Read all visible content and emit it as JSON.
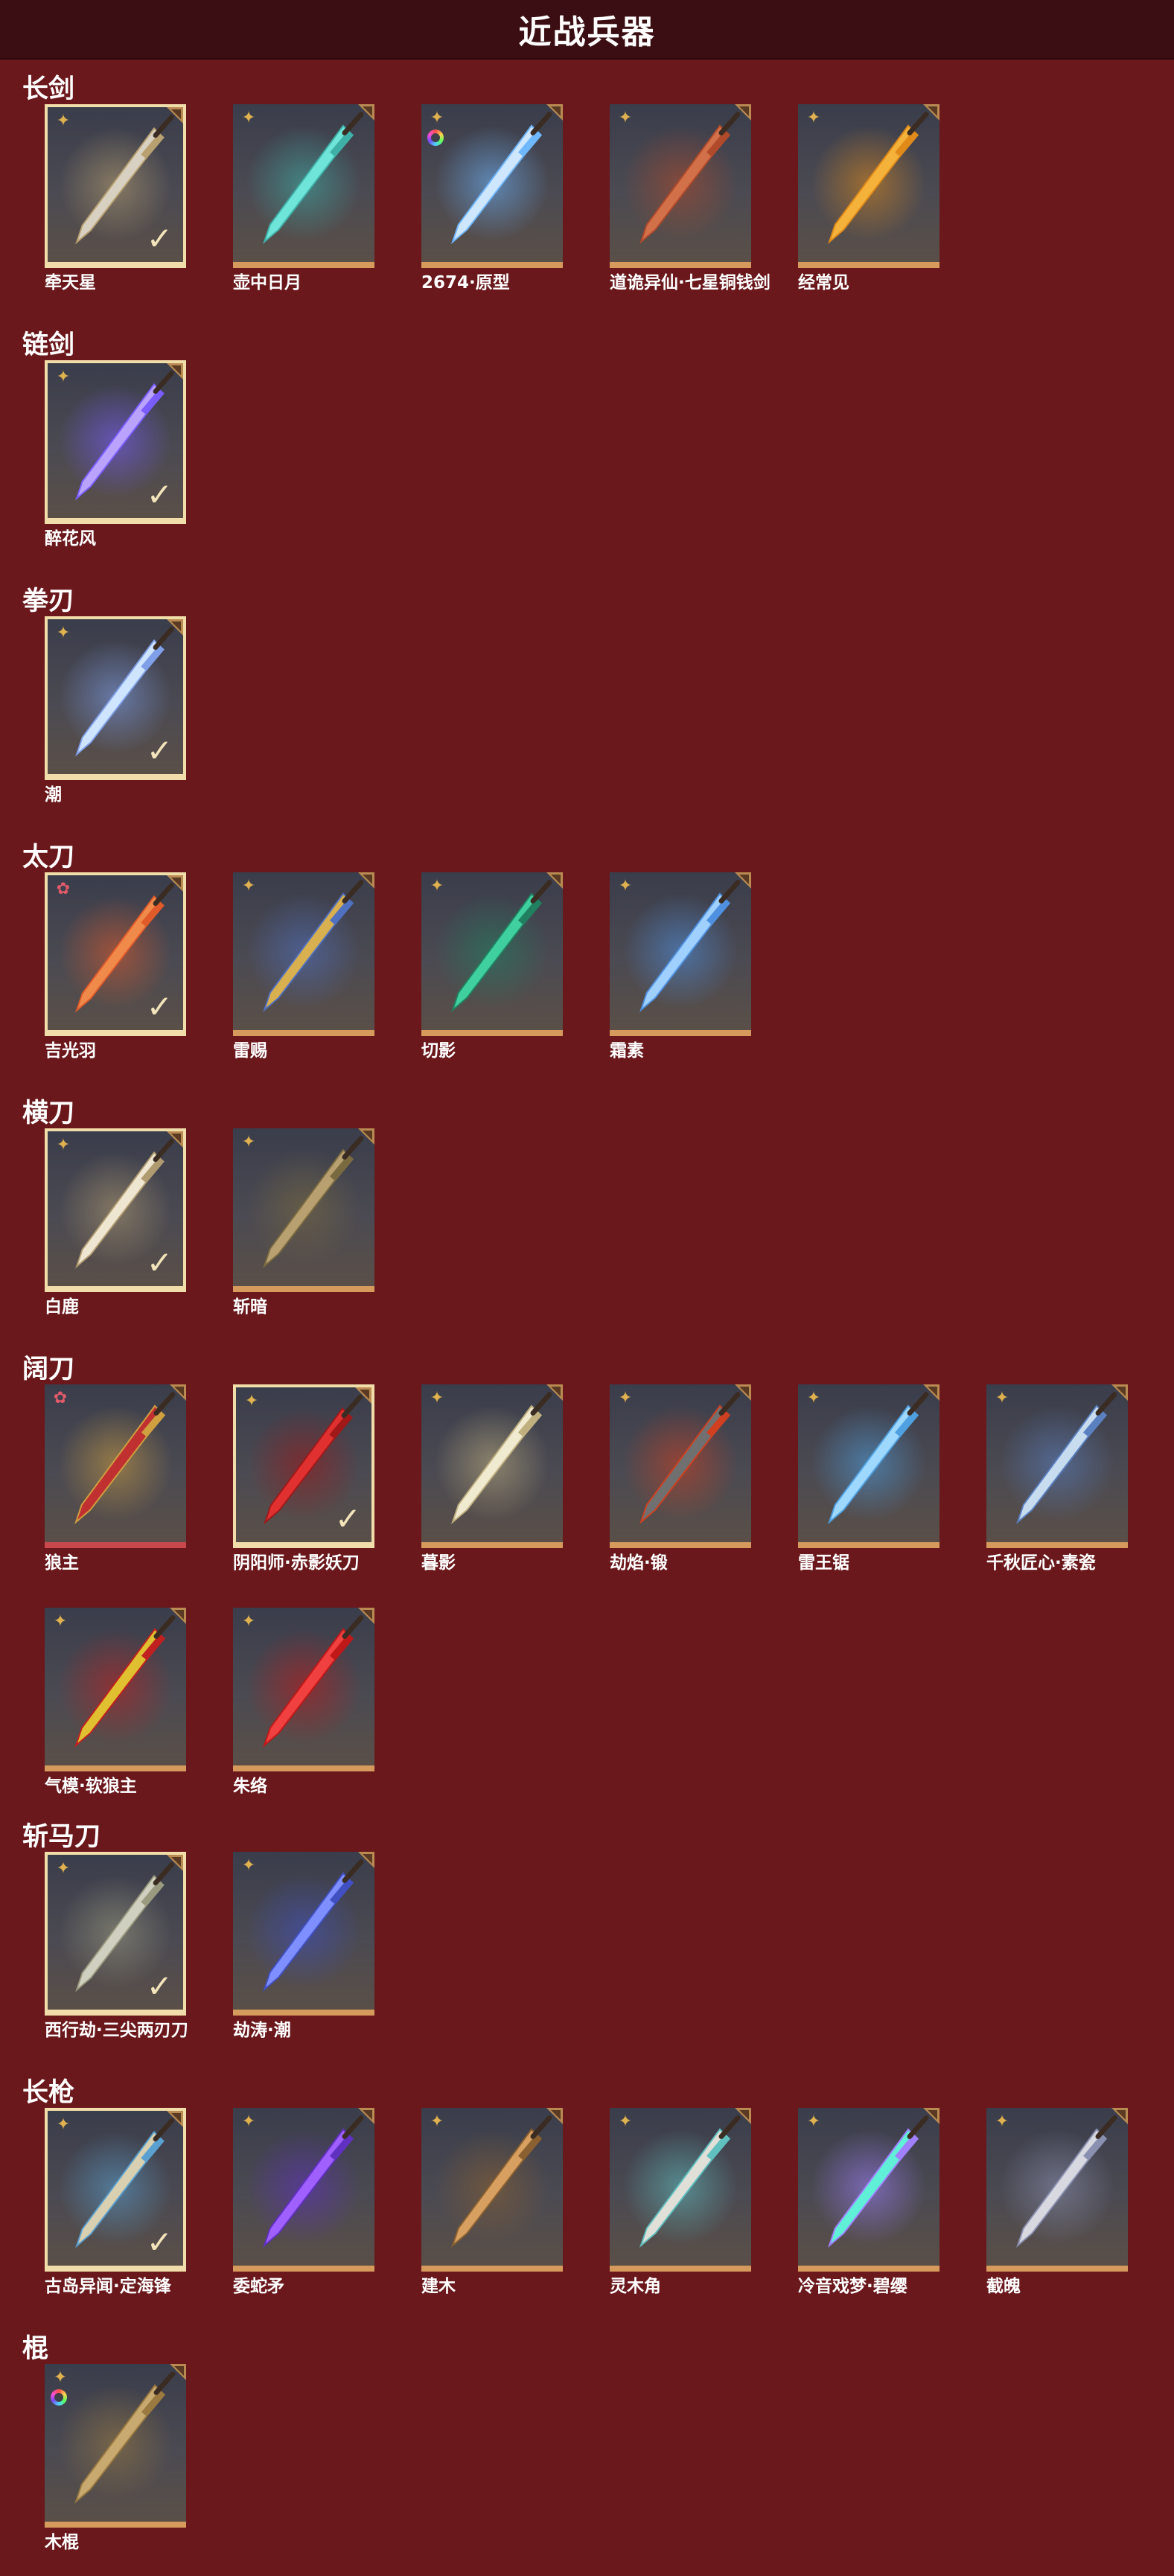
{
  "page": {
    "title": "近战兵器"
  },
  "colors": {
    "background": "#6a181c",
    "header": "#3a0e12",
    "card_border": "#d69a5d",
    "equipped_border": "#f1dda9"
  },
  "categories": [
    {
      "name": "长剑",
      "items": [
        {
          "name": "牵天星",
          "rank_icon": "gold-star-icon",
          "equipped": true,
          "blade": "#d8d0c0",
          "glow": "#b8a070"
        },
        {
          "name": "壶中日月",
          "rank_icon": "gold-star-icon",
          "equipped": false,
          "blade": "#6fe4d8",
          "glow": "#3fb0a8"
        },
        {
          "name": "2674·原型",
          "rank_icon": "rainbow-ring-icon",
          "equipped": false,
          "blade": "#cfe6ff",
          "glow": "#6fb7ff"
        },
        {
          "name": "道诡异仙·七星铜钱剑",
          "rank_icon": "gold-star-icon",
          "equipped": false,
          "blade": "#d2704a",
          "glow": "#b04a2a"
        },
        {
          "name": "经常见",
          "rank_icon": "gold-star-icon",
          "equipped": false,
          "blade": "#f5b23a",
          "glow": "#e08a1a"
        }
      ]
    },
    {
      "name": "链剑",
      "items": [
        {
          "name": "醉花风",
          "rank_icon": "gold-star-icon",
          "equipped": true,
          "blade": "#b9a3ff",
          "glow": "#7a5cff"
        }
      ]
    },
    {
      "name": "拳刃",
      "items": [
        {
          "name": "潮",
          "rank_icon": "gold-star-icon",
          "equipped": true,
          "blade": "#cfe4ff",
          "glow": "#7f9fe8"
        }
      ]
    },
    {
      "name": "太刀",
      "items": [
        {
          "name": "吉光羽",
          "rank_icon": "red-star-icon",
          "equipped": true,
          "blade": "#f08a4a",
          "glow": "#e05a2a"
        },
        {
          "name": "雷赐",
          "rank_icon": "gold-star-icon",
          "equipped": false,
          "blade": "#d8b050",
          "glow": "#5070c0"
        },
        {
          "name": "切影",
          "rank_icon": "gold-star-icon",
          "equipped": false,
          "blade": "#40d0a0",
          "glow": "#208060"
        },
        {
          "name": "霜素",
          "rank_icon": "gold-star-icon",
          "equipped": false,
          "blade": "#9fd0ff",
          "glow": "#4f90e0"
        }
      ]
    },
    {
      "name": "横刀",
      "items": [
        {
          "name": "白鹿",
          "rank_icon": "gold-star-icon",
          "equipped": true,
          "blade": "#eee6d0",
          "glow": "#b09a70"
        },
        {
          "name": "斩暗",
          "rank_icon": "gold-star-icon",
          "equipped": false,
          "blade": "#b8a070",
          "glow": "#7a6a40"
        }
      ]
    },
    {
      "name": "阔刀",
      "items": [
        {
          "name": "狼主",
          "rank_icon": "red-star-icon",
          "equipped": false,
          "red_bottom": true,
          "blade": "#c03030",
          "glow": "#d0a040"
        },
        {
          "name": "阴阳师·赤影妖刀",
          "rank_icon": "gold-star-icon",
          "equipped": true,
          "blade": "#e03030",
          "glow": "#a01818"
        },
        {
          "name": "暮影",
          "rank_icon": "gold-star-icon",
          "equipped": false,
          "blade": "#f0ead0",
          "glow": "#c0b080"
        },
        {
          "name": "劫焰·锻",
          "rank_icon": "gold-star-icon",
          "equipped": false,
          "blade": "#707070",
          "glow": "#d04020"
        },
        {
          "name": "雷王锯",
          "rank_icon": "gold-star-icon",
          "equipped": false,
          "blade": "#9fd8ff",
          "glow": "#4fa0e0"
        },
        {
          "name": "千秋匠心·素瓷",
          "rank_icon": "gold-star-icon",
          "equipped": false,
          "blade": "#c8dcf0",
          "glow": "#5a80c0"
        },
        {
          "name": "气模·软狼主",
          "rank_icon": "gold-star-icon",
          "equipped": false,
          "blade": "#e0c030",
          "glow": "#c02020"
        },
        {
          "name": "朱络",
          "rank_icon": "gold-star-icon",
          "equipped": false,
          "blade": "#f04040",
          "glow": "#c01818"
        }
      ]
    },
    {
      "name": "斩马刀",
      "items": [
        {
          "name": "西行劫·三尖两刃刀",
          "rank_icon": "gold-star-icon",
          "equipped": true,
          "blade": "#d0d0c0",
          "glow": "#9a9a80"
        },
        {
          "name": "劫涛·潮",
          "rank_icon": "gold-star-icon",
          "equipped": false,
          "blade": "#7f8fff",
          "glow": "#4050c0"
        }
      ]
    },
    {
      "name": "长枪",
      "items": [
        {
          "name": "古岛异闻·定海锋",
          "rank_icon": "gold-star-icon",
          "equipped": true,
          "blade": "#d8d0b0",
          "glow": "#5aa0d0"
        },
        {
          "name": "委蛇矛",
          "rank_icon": "gold-star-icon",
          "equipped": false,
          "blade": "#a060ff",
          "glow": "#6030c0"
        },
        {
          "name": "建木",
          "rank_icon": "gold-star-icon",
          "equipped": false,
          "blade": "#d8a060",
          "glow": "#8a6030"
        },
        {
          "name": "灵木角",
          "rank_icon": "gold-star-icon",
          "equipped": false,
          "blade": "#e0e0d8",
          "glow": "#60c0c0"
        },
        {
          "name": "冷音戏梦·碧缨",
          "rank_icon": "gold-star-icon",
          "equipped": false,
          "blade": "#60f0d8",
          "glow": "#a080ff"
        },
        {
          "name": "截魄",
          "rank_icon": "gold-star-icon",
          "equipped": false,
          "blade": "#d8d8e0",
          "glow": "#8a90b0"
        }
      ]
    },
    {
      "name": "棍",
      "items": [
        {
          "name": "木棍",
          "rank_icon": "rainbow-ring-icon",
          "equipped": false,
          "blade": "#c8aa70",
          "glow": "#9a7a40"
        }
      ]
    }
  ]
}
